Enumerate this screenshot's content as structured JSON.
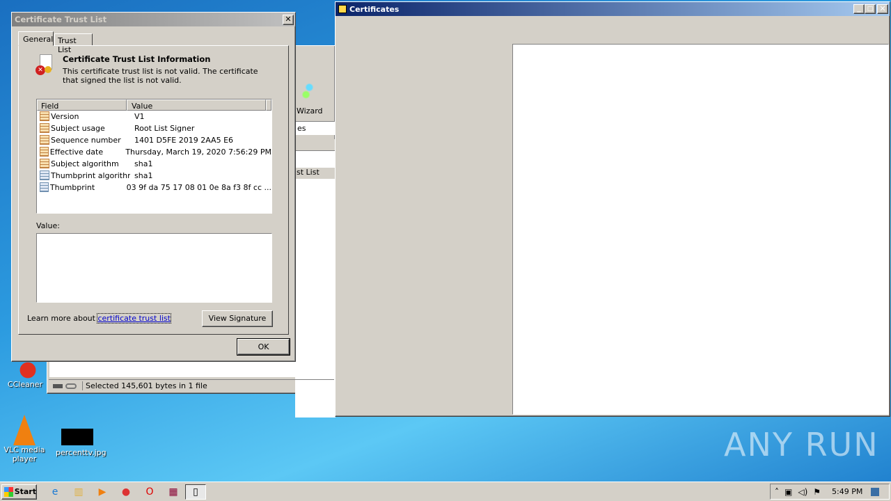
{
  "desktop": {
    "icons": [
      {
        "label": "CCleaner"
      },
      {
        "label": "VLC media player"
      },
      {
        "label": "percenttv.jpg"
      }
    ],
    "watermark": "ANY RUN"
  },
  "bg_window": {
    "toolbar_label": "Wizard",
    "address_fragment": "es",
    "list_item_fragment": "st List",
    "status_text": "Selected 145,601 bytes in 1 file"
  },
  "certificates_window": {
    "title": "Certificates"
  },
  "dialog": {
    "title": "Certificate Trust List",
    "tabs": [
      {
        "label": "General",
        "active": true
      },
      {
        "label": "Trust List",
        "active": false
      }
    ],
    "heading": "Certificate Trust List Information",
    "message": "This certificate trust list is not valid.  The certificate that signed the list is not valid.",
    "table": {
      "columns": [
        "Field",
        "Value"
      ],
      "rows": [
        {
          "field": "Version",
          "value": "V1",
          "icon": "property-icon"
        },
        {
          "field": "Subject usage",
          "value": "Root List Signer",
          "icon": "property-icon"
        },
        {
          "field": "Sequence number",
          "value": "1401 D5FE 2019 2AA5 E6",
          "icon": "property-icon"
        },
        {
          "field": "Effective date",
          "value": "Thursday, March 19, 2020 7:56:29 PM",
          "icon": "property-icon"
        },
        {
          "field": "Subject algorithm",
          "value": "sha1",
          "icon": "property-icon"
        },
        {
          "field": "Thumbprint algorithm",
          "value": "sha1",
          "icon": "extension-icon"
        },
        {
          "field": "Thumbprint",
          "value": "03 9f da 75 17 08 01 0e 8a f3 8f cc ...",
          "icon": "extension-icon"
        }
      ]
    },
    "value_label": "Value:",
    "value_text": "",
    "learn_more_prefix": "Learn more about ",
    "learn_more_link": "certificate trust list",
    "view_signature_label": "View Signature",
    "ok_label": "OK"
  },
  "taskbar": {
    "start_label": "Start",
    "clock": "5:49 PM"
  }
}
